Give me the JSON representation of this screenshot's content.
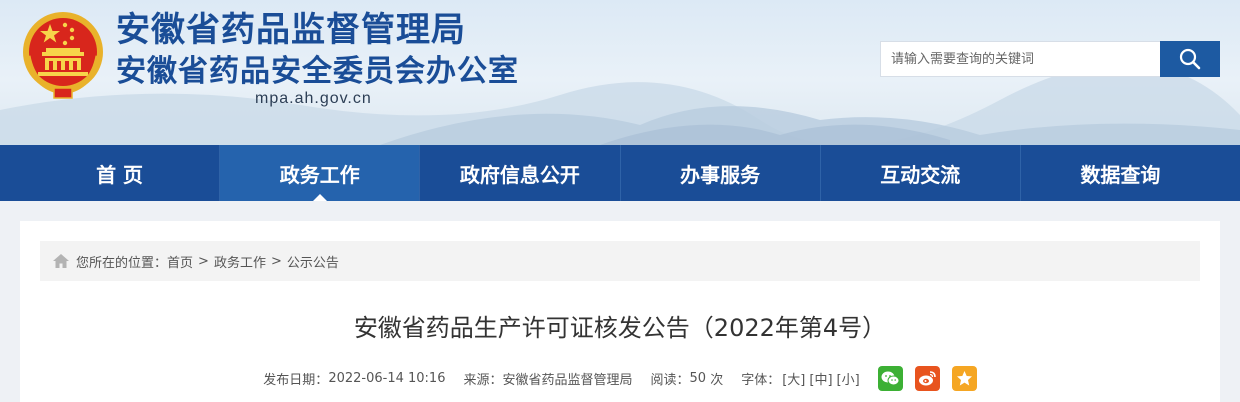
{
  "header": {
    "title": "安徽省药品监督管理局",
    "subtitle": "安徽省药品安全委员会办公室",
    "domain": "mpa.ah.gov.cn"
  },
  "search": {
    "placeholder": "请输入需要查询的关键词"
  },
  "nav": {
    "items": [
      {
        "label": "首 页"
      },
      {
        "label": "政务工作"
      },
      {
        "label": "政府信息公开"
      },
      {
        "label": "办事服务"
      },
      {
        "label": "互动交流"
      },
      {
        "label": "数据查询"
      }
    ],
    "active_index": 1
  },
  "breadcrumb": {
    "prefix": "您所在的位置：",
    "items": [
      "首页",
      "政务工作",
      "公示公告"
    ],
    "separator": ">"
  },
  "article": {
    "title": "安徽省药品生产许可证核发公告（2022年第4号）",
    "date_label": "发布日期：",
    "date": "2022-06-14 10:16",
    "source_label": "来源：",
    "source": "安徽省药品监督管理局",
    "views_label": "阅读：",
    "views": "50",
    "views_unit": "次",
    "font_label": "字体：",
    "font_large": "[大]",
    "font_medium": "[中]",
    "font_small": "[小]"
  },
  "share": {
    "icons": [
      "wechat-icon",
      "weibo-icon",
      "favorite-star-icon"
    ]
  },
  "colors": {
    "brand_blue": "#1a4d97",
    "nav_active": "#2563ad",
    "search_button": "#1d5aa2",
    "emblem_red": "#d8261c",
    "emblem_gold": "#e9b22b",
    "wechat_green": "#3cb034",
    "weibo_orange": "#e8541e",
    "favorite_yellow": "#f5a623"
  }
}
